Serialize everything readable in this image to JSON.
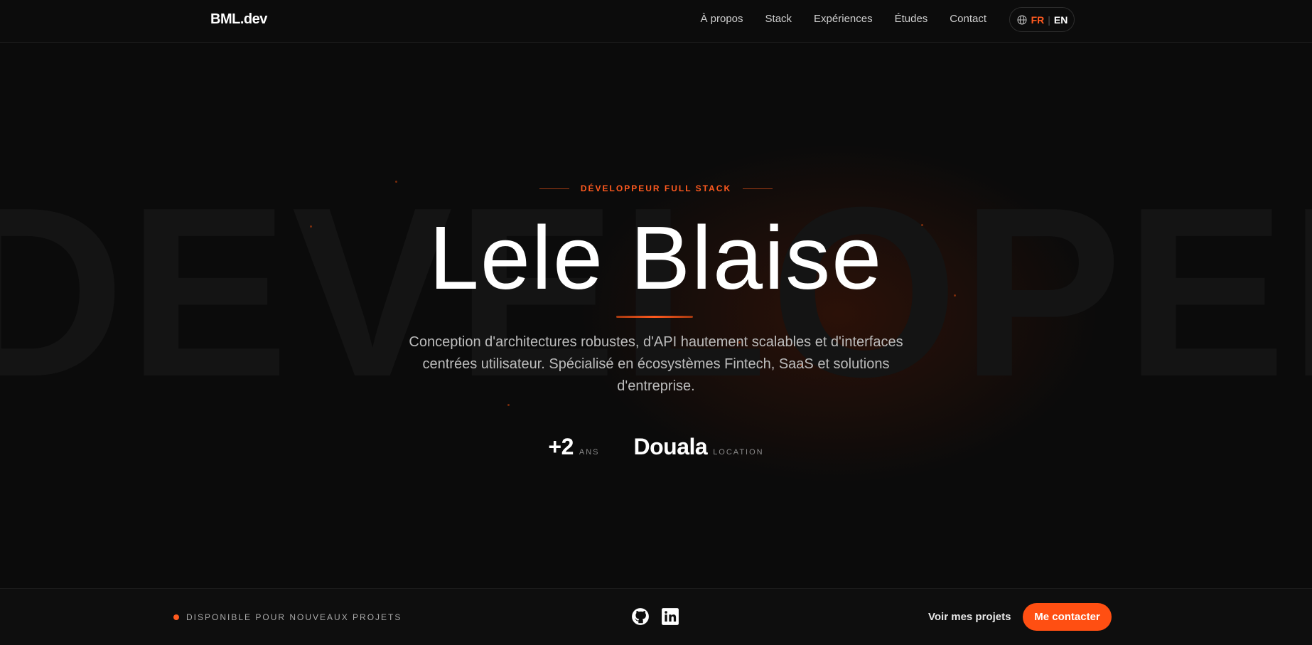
{
  "header": {
    "logo": "BML.dev",
    "nav": [
      "À propos",
      "Stack",
      "Expériences",
      "Études",
      "Contact"
    ],
    "lang": {
      "icon": "globe-icon",
      "active": "FR",
      "separator": "|",
      "other": "EN"
    }
  },
  "hero": {
    "background_word": "DEVELOPER",
    "eyebrow": "DÉVELOPPEUR FULL STACK",
    "name": "Lele Blaise",
    "description": "Conception d'architectures robustes, d'API hautement scalables et d'interfaces centrées utilisateur. Spécialisé en écosystèmes Fintech, SaaS et solutions d'entreprise.",
    "stats": [
      {
        "value": "+2",
        "label": "ANS"
      },
      {
        "value": "Douala",
        "label": "LOCATION"
      }
    ]
  },
  "footer": {
    "availability": "DISPONIBLE POUR NOUVEAUX PROJETS",
    "socials": [
      "github-icon",
      "linkedin-icon"
    ],
    "projects_link": "Voir mes projets",
    "cta": "Me contacter"
  },
  "colors": {
    "accent": "#ff5a1f",
    "background": "#0b0b0b"
  }
}
